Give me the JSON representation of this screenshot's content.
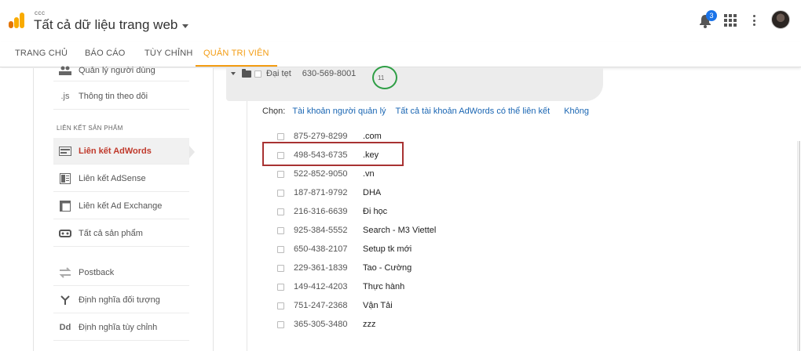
{
  "header": {
    "account_small": "ccc",
    "property_title": "Tất cả dữ liệu trang web",
    "notification_count": "3"
  },
  "tabs": [
    {
      "label": "TRANG CHỦ"
    },
    {
      "label": "BÁO CÁO"
    },
    {
      "label": "TÙY CHỈNH"
    },
    {
      "label": "QUẢN TRỊ VIÊN"
    }
  ],
  "sidebar": {
    "items": [
      {
        "label": "Quản lý người dùng",
        "icon": "users-icon"
      },
      {
        "label": "Thông tin theo dõi",
        "icon": "js-icon"
      },
      {
        "label": "Liên kết AdWords",
        "icon": "adwords-icon"
      },
      {
        "label": "Liên kết AdSense",
        "icon": "adsense-icon"
      },
      {
        "label": "Liên kết Ad Exchange",
        "icon": "ad-exchange-icon"
      },
      {
        "label": "Tất cả sản phẩm",
        "icon": "link-icon"
      },
      {
        "label": "Postback",
        "icon": "postback-icon"
      },
      {
        "label": "Định nghĩa đối tượng",
        "icon": "audience-icon"
      },
      {
        "label": "Định nghĩa tùy chỉnh",
        "icon": "dd-icon"
      }
    ],
    "section_label": "LIÊN KẾT SẢN PHẨM",
    "js_glyph": ".js",
    "dd_glyph": "Dd"
  },
  "main": {
    "group": {
      "name": "Đại tẹt",
      "id": "630-569-8001",
      "count": "11"
    },
    "select": {
      "label": "Chọn:",
      "options": [
        "Tài khoản người quản lý",
        "Tất cả tài khoản AdWords có thể liên kết",
        "Không"
      ]
    },
    "accounts": [
      {
        "id": "875-279-8299",
        "name": ".com"
      },
      {
        "id": "498-543-6735",
        "name": ".key"
      },
      {
        "id": "522-852-9050",
        "name": ".vn"
      },
      {
        "id": "187-871-9792",
        "name": "DHA"
      },
      {
        "id": "216-316-6639",
        "name": "Đi học"
      },
      {
        "id": "925-384-5552",
        "name": "Search - M3 Viettel"
      },
      {
        "id": "650-438-2107",
        "name": "Setup tk mới"
      },
      {
        "id": "229-361-1839",
        "name": "Tao - Cường"
      },
      {
        "id": "149-412-4203",
        "name": "Thực hành"
      },
      {
        "id": "751-247-2368",
        "name": "Vận Tải"
      },
      {
        "id": "365-305-3480",
        "name": "zzz"
      }
    ]
  },
  "colors": {
    "accent": "#f39c12",
    "active_item": "#c0392b",
    "link": "#1a66b3",
    "highlight_box": "#a83232",
    "badge": "#1a73e8"
  }
}
